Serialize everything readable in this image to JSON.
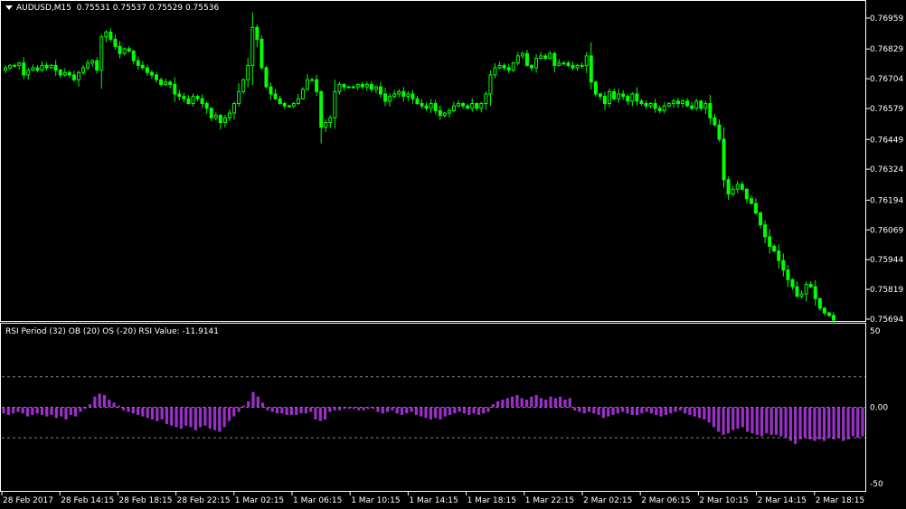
{
  "header": {
    "symbol": "AUDUSD,M15",
    "quotes": "0.75531 0.75537 0.75529 0.75536"
  },
  "rsi_panel": {
    "label": "RSI Period (32) OB (20) OS (-20) RSI Value: -11.9141",
    "levels": [
      "50",
      "0.00",
      "-50"
    ]
  },
  "colors": {
    "candle": "#00ff00",
    "histogram": "#9b30c8",
    "background": "#000000",
    "grid": "#808080"
  },
  "chart_data": [
    {
      "type": "candlestick",
      "title": "AUDUSD,M15",
      "price_ticks": [
        "0.76959",
        "0.76829",
        "0.76704",
        "0.76579",
        "0.76449",
        "0.76324",
        "0.76194",
        "0.76069",
        "0.75944",
        "0.75819",
        "0.75694"
      ],
      "ylim": [
        0.7567,
        0.77
      ],
      "time_labels": [
        "28 Feb 2017",
        "28 Feb 14:15",
        "28 Feb 18:15",
        "28 Feb 22:15",
        "1 Mar 02:15",
        "1 Mar 06:15",
        "1 Mar 10:15",
        "1 Mar 14:15",
        "1 Mar 18:15",
        "1 Mar 22:15",
        "2 Mar 02:15",
        "2 Mar 06:15",
        "2 Mar 10:15",
        "2 Mar 14:15",
        "2 Mar 18:15"
      ],
      "close": [
        0.7675,
        0.7676,
        0.7676,
        0.7677,
        0.7672,
        0.7674,
        0.7675,
        0.7674,
        0.7676,
        0.7675,
        0.7676,
        0.7674,
        0.7672,
        0.7673,
        0.7672,
        0.767,
        0.7673,
        0.7675,
        0.7677,
        0.7678,
        0.7674,
        0.7688,
        0.769,
        0.7687,
        0.7684,
        0.7681,
        0.7683,
        0.7682,
        0.7678,
        0.7676,
        0.7675,
        0.7673,
        0.7672,
        0.767,
        0.7668,
        0.7669,
        0.7668,
        0.7664,
        0.7663,
        0.7662,
        0.766,
        0.7663,
        0.7662,
        0.766,
        0.7658,
        0.7654,
        0.7655,
        0.7652,
        0.7654,
        0.7656,
        0.766,
        0.7665,
        0.767,
        0.7676,
        0.7692,
        0.7687,
        0.7675,
        0.7667,
        0.7664,
        0.7662,
        0.766,
        0.7659,
        0.7659,
        0.766,
        0.7662,
        0.7666,
        0.767,
        0.767,
        0.7665,
        0.765,
        0.7652,
        0.7654,
        0.7665,
        0.7668,
        0.7667,
        0.7667,
        0.7667,
        0.7668,
        0.7667,
        0.7668,
        0.7666,
        0.7667,
        0.7664,
        0.7661,
        0.7663,
        0.7664,
        0.7665,
        0.7663,
        0.7664,
        0.7662,
        0.766,
        0.7659,
        0.7658,
        0.766,
        0.7657,
        0.7655,
        0.7656,
        0.7657,
        0.7659,
        0.766,
        0.7659,
        0.7658,
        0.766,
        0.7658,
        0.766,
        0.7664,
        0.7672,
        0.7675,
        0.7676,
        0.7675,
        0.7674,
        0.7677,
        0.768,
        0.7681,
        0.7676,
        0.7675,
        0.7679,
        0.768,
        0.7679,
        0.7681,
        0.7676,
        0.7677,
        0.7677,
        0.7676,
        0.7675,
        0.7676,
        0.7676,
        0.768,
        0.7669,
        0.7664,
        0.7663,
        0.766,
        0.7665,
        0.7662,
        0.7664,
        0.7663,
        0.7661,
        0.7664,
        0.7661,
        0.766,
        0.7659,
        0.766,
        0.7658,
        0.7657,
        0.7659,
        0.766,
        0.7661,
        0.766,
        0.7661,
        0.7659,
        0.7658,
        0.7661,
        0.7658,
        0.766,
        0.7654,
        0.7651,
        0.7645,
        0.7628,
        0.7622,
        0.7624,
        0.7626,
        0.7624,
        0.762,
        0.7618,
        0.7614,
        0.7609,
        0.7604,
        0.76,
        0.7598,
        0.7594,
        0.759,
        0.7586,
        0.7583,
        0.7579,
        0.758,
        0.7584,
        0.7583,
        0.7578,
        0.7574,
        0.7572,
        0.7571,
        0.7569
      ]
    },
    {
      "type": "bar",
      "title": "RSI Period (32) OB (20) OS (-20) RSI Value: -11.9141",
      "ylim": [
        -50,
        50
      ],
      "levels": [
        20,
        0,
        -20
      ],
      "values": [
        -4,
        -5,
        -4,
        -3,
        -4,
        -6,
        -5,
        -4,
        -5,
        -6,
        -5,
        -7,
        -6,
        -8,
        -5,
        -6,
        -3,
        -1,
        2,
        7,
        9,
        8,
        5,
        3,
        1,
        -2,
        -3,
        -4,
        -5,
        -6,
        -7,
        -8,
        -9,
        -8,
        -11,
        -12,
        -13,
        -14,
        -12,
        -13,
        -15,
        -13,
        -12,
        -14,
        -15,
        -16,
        -13,
        -9,
        -6,
        -3,
        1,
        4,
        10,
        7,
        3,
        -2,
        -3,
        -4,
        -4,
        -5,
        -5,
        -5,
        -4,
        -4,
        -3,
        -8,
        -9,
        -8,
        -3,
        -2,
        -2,
        -1,
        -1,
        -1,
        -2,
        -2,
        -1,
        -1,
        -3,
        -4,
        -3,
        -2,
        -4,
        -5,
        -4,
        -3,
        -5,
        -6,
        -7,
        -8,
        -7,
        -8,
        -6,
        -5,
        -4,
        -3,
        -4,
        -5,
        -4,
        -5,
        -4,
        -3,
        2,
        4,
        5,
        6,
        7,
        8,
        6,
        5,
        7,
        8,
        6,
        5,
        7,
        6,
        7,
        5,
        6,
        -2,
        -3,
        -4,
        -3,
        -4,
        -5,
        -7,
        -6,
        -5,
        -4,
        -3,
        -4,
        -5,
        -5,
        -4,
        -3,
        -4,
        -5,
        -6,
        -5,
        -4,
        -3,
        -2,
        -4,
        -5,
        -6,
        -7,
        -8,
        -10,
        -13,
        -16,
        -18,
        -17,
        -15,
        -14,
        -13,
        -16,
        -17,
        -18,
        -19,
        -17,
        -18,
        -18,
        -19,
        -20,
        -22,
        -24,
        -21,
        -20,
        -21,
        -22,
        -21,
        -22,
        -20,
        -21,
        -20,
        -22,
        -21,
        -19,
        -20,
        -19
      ]
    }
  ]
}
